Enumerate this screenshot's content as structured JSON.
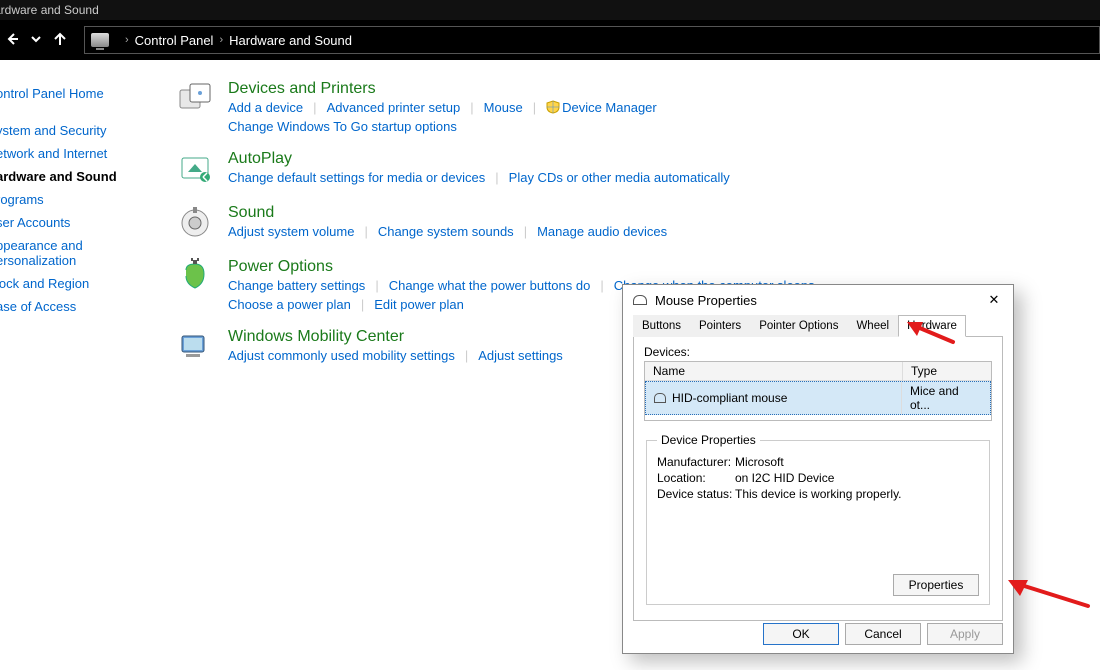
{
  "window": {
    "title": "ardware and Sound"
  },
  "nav": {
    "back": "←",
    "dropdown": "⌄",
    "up": "↑"
  },
  "breadcrumb": {
    "sep1": "›",
    "root": "Control Panel",
    "sep2": "›",
    "current": "Hardware and Sound"
  },
  "sidebar": {
    "home": "ontrol Panel Home",
    "items": [
      "ystem and Security",
      "etwork and Internet",
      "ardware and Sound",
      "rograms",
      "ser Accounts",
      "ppearance and\nersonalization",
      "lock and Region",
      "ase of Access"
    ]
  },
  "categories": [
    {
      "title": "Devices and Printers",
      "links": [
        "Add a device",
        "Advanced printer setup",
        "Mouse",
        "Device Manager",
        "Change Windows To Go startup options"
      ],
      "shield_at": 3,
      "break_after": 3
    },
    {
      "title": "AutoPlay",
      "links": [
        "Change default settings for media or devices",
        "Play CDs or other media automatically"
      ]
    },
    {
      "title": "Sound",
      "links": [
        "Adjust system volume",
        "Change system sounds",
        "Manage audio devices"
      ]
    },
    {
      "title": "Power Options",
      "links": [
        "Change battery settings",
        "Change what the power buttons do",
        "Change when the computer sleeps",
        "Choose a power plan",
        "Edit power plan"
      ],
      "break_after": 2
    },
    {
      "title": "Windows Mobility Center",
      "links": [
        "Adjust commonly used mobility settings",
        "Adjust settings"
      ]
    }
  ],
  "dialog": {
    "title": "Mouse Properties",
    "tabs": [
      "Buttons",
      "Pointers",
      "Pointer Options",
      "Wheel",
      "Hardware"
    ],
    "active_tab": 4,
    "devices_label": "Devices:",
    "col_name": "Name",
    "col_type": "Type",
    "row_name": "HID-compliant mouse",
    "row_type": "Mice and ot...",
    "legend": "Device Properties",
    "props": {
      "manufacturer_l": "Manufacturer:",
      "manufacturer_v": "Microsoft",
      "location_l": "Location:",
      "location_v": "on I2C HID Device",
      "status_l": "Device status:",
      "status_v": "This device is working properly."
    },
    "properties_btn": "Properties",
    "ok": "OK",
    "cancel": "Cancel",
    "apply": "Apply"
  }
}
